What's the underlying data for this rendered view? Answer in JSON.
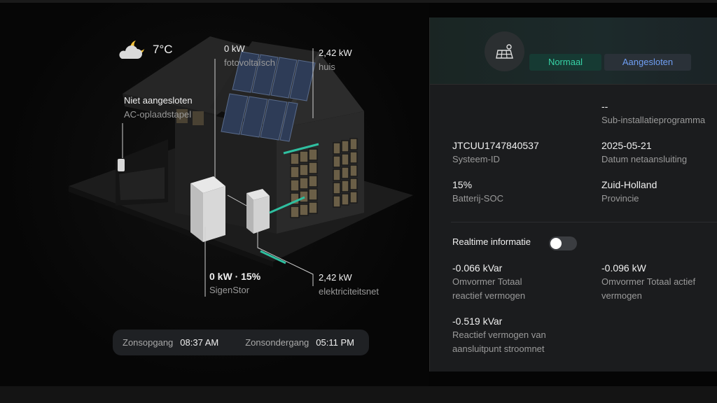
{
  "weather": {
    "temperature": "7°C",
    "icon": "moon-cloud-icon"
  },
  "scene": {
    "pv": {
      "value": "0 kW",
      "label": "fotovoltaïsch"
    },
    "home": {
      "value": "2,42 kW",
      "label": "huis"
    },
    "charger": {
      "value": "Niet aangesloten",
      "label": "AC-oplaadstapel"
    },
    "battery": {
      "value": "0 kW · 15%",
      "label": "SigenStor"
    },
    "grid": {
      "value": "2,42 kW",
      "label": "elektriciteitsnet"
    }
  },
  "sun": {
    "sunrise_label": "Zonsopgang",
    "sunrise_time": "08:37 AM",
    "sunset_label": "Zonsondergang",
    "sunset_time": "05:11 PM"
  },
  "panel": {
    "icon": "solar-panel-icon",
    "status_normal": "Normaal",
    "status_connected": "Aangesloten",
    "sub_installer": {
      "value": "--",
      "label": "Sub-installatieprogramma"
    },
    "system_id": {
      "value": "JTCUU1747840537",
      "label": "Systeem-ID"
    },
    "grid_date": {
      "value": "2025-05-21",
      "label": "Datum netaansluiting"
    },
    "battery_soc": {
      "value": "15%",
      "label": "Batterij-SOC"
    },
    "province": {
      "value": "Zuid-Holland",
      "label": "Provincie"
    },
    "realtime": {
      "label": "Realtime informatie",
      "enabled": false
    },
    "reactive_total": {
      "value": "-0.066 kVar",
      "label_line1": "Omvormer Totaal",
      "label_line2": "reactief vermogen"
    },
    "active_total": {
      "value": "-0.096 kW",
      "label_line1": "Omvormer Totaal actief",
      "label_line2": "vermogen"
    },
    "reactive_grid": {
      "value": "-0.519 kVar",
      "label_line1": "Reactief vermogen van",
      "label_line2": "aansluitpunt stroomnet"
    }
  },
  "colors": {
    "accent_green": "#37d2a6",
    "accent_blue": "#6f9ef3",
    "panel_bg": "#1b1c1e"
  }
}
